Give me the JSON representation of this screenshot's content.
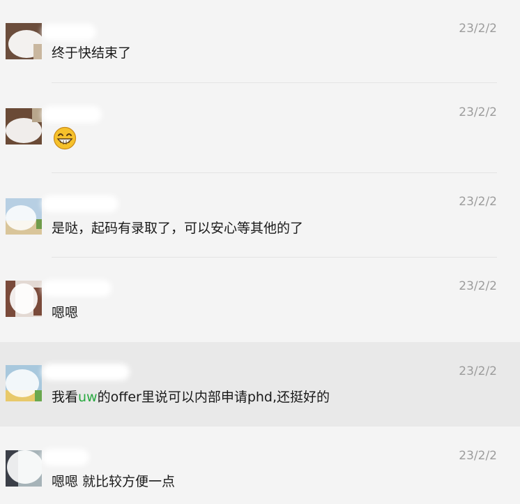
{
  "comments": [
    {
      "date": "23/2/2",
      "text": "终于快结束了",
      "avatar_colors": [
        "#6b4d3c",
        "#c9b79f"
      ]
    },
    {
      "date": "23/2/2",
      "emoji": "grinning-face-emoji",
      "avatar_colors": [
        "#6a4a36",
        "#b8a68c"
      ]
    },
    {
      "date": "23/2/2",
      "text": "是哒，起码有录取了，可以安心等其他的了",
      "avatar_colors": [
        "#b7cfe3",
        "#d9c59a"
      ]
    },
    {
      "date": "23/2/2",
      "text": "嗯嗯",
      "avatar_colors": [
        "#7a4a3a",
        "#e3d9d3"
      ]
    },
    {
      "date": "23/2/2",
      "text_parts": [
        "我看",
        "uw",
        "的offer里说可以内部申请phd,还挺好的"
      ],
      "avatar_colors": [
        "#a8c8dd",
        "#e8c96a"
      ]
    },
    {
      "date": "23/2/2",
      "text": "嗯嗯 就比较方便一点",
      "avatar_colors": [
        "#3b3f48",
        "#a6b3b8"
      ]
    }
  ],
  "colors": {
    "accent": "#28a940",
    "text": "#191919",
    "date": "#9c9c9c",
    "background": "#f4f4f4",
    "highlight_row": "#e9e9e9"
  }
}
